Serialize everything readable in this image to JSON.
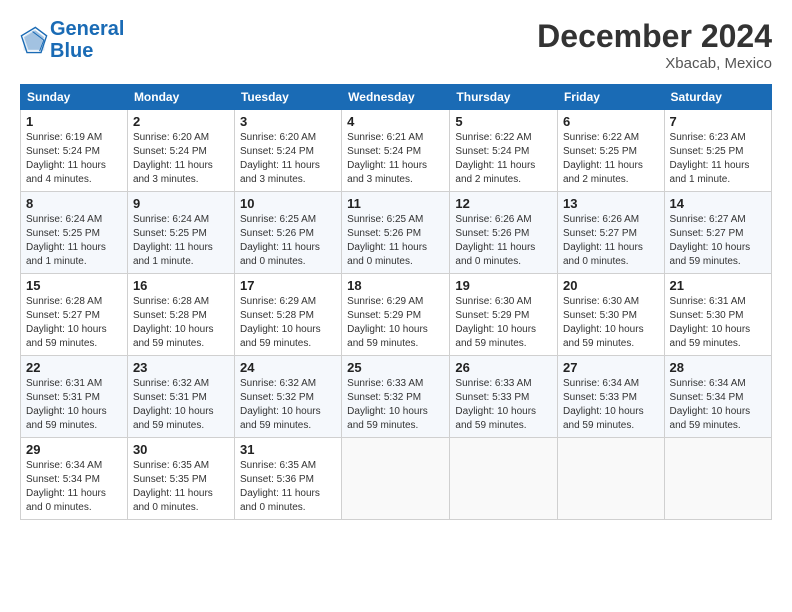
{
  "header": {
    "logo_line1": "General",
    "logo_line2": "Blue",
    "month_title": "December 2024",
    "location": "Xbacab, Mexico"
  },
  "weekdays": [
    "Sunday",
    "Monday",
    "Tuesday",
    "Wednesday",
    "Thursday",
    "Friday",
    "Saturday"
  ],
  "weeks": [
    [
      {
        "day": "1",
        "sunrise": "6:19 AM",
        "sunset": "5:24 PM",
        "daylight": "11 hours and 4 minutes."
      },
      {
        "day": "2",
        "sunrise": "6:20 AM",
        "sunset": "5:24 PM",
        "daylight": "11 hours and 3 minutes."
      },
      {
        "day": "3",
        "sunrise": "6:20 AM",
        "sunset": "5:24 PM",
        "daylight": "11 hours and 3 minutes."
      },
      {
        "day": "4",
        "sunrise": "6:21 AM",
        "sunset": "5:24 PM",
        "daylight": "11 hours and 3 minutes."
      },
      {
        "day": "5",
        "sunrise": "6:22 AM",
        "sunset": "5:24 PM",
        "daylight": "11 hours and 2 minutes."
      },
      {
        "day": "6",
        "sunrise": "6:22 AM",
        "sunset": "5:25 PM",
        "daylight": "11 hours and 2 minutes."
      },
      {
        "day": "7",
        "sunrise": "6:23 AM",
        "sunset": "5:25 PM",
        "daylight": "11 hours and 1 minute."
      }
    ],
    [
      {
        "day": "8",
        "sunrise": "6:24 AM",
        "sunset": "5:25 PM",
        "daylight": "11 hours and 1 minute."
      },
      {
        "day": "9",
        "sunrise": "6:24 AM",
        "sunset": "5:25 PM",
        "daylight": "11 hours and 1 minute."
      },
      {
        "day": "10",
        "sunrise": "6:25 AM",
        "sunset": "5:26 PM",
        "daylight": "11 hours and 0 minutes."
      },
      {
        "day": "11",
        "sunrise": "6:25 AM",
        "sunset": "5:26 PM",
        "daylight": "11 hours and 0 minutes."
      },
      {
        "day": "12",
        "sunrise": "6:26 AM",
        "sunset": "5:26 PM",
        "daylight": "11 hours and 0 minutes."
      },
      {
        "day": "13",
        "sunrise": "6:26 AM",
        "sunset": "5:27 PM",
        "daylight": "11 hours and 0 minutes."
      },
      {
        "day": "14",
        "sunrise": "6:27 AM",
        "sunset": "5:27 PM",
        "daylight": "10 hours and 59 minutes."
      }
    ],
    [
      {
        "day": "15",
        "sunrise": "6:28 AM",
        "sunset": "5:27 PM",
        "daylight": "10 hours and 59 minutes."
      },
      {
        "day": "16",
        "sunrise": "6:28 AM",
        "sunset": "5:28 PM",
        "daylight": "10 hours and 59 minutes."
      },
      {
        "day": "17",
        "sunrise": "6:29 AM",
        "sunset": "5:28 PM",
        "daylight": "10 hours and 59 minutes."
      },
      {
        "day": "18",
        "sunrise": "6:29 AM",
        "sunset": "5:29 PM",
        "daylight": "10 hours and 59 minutes."
      },
      {
        "day": "19",
        "sunrise": "6:30 AM",
        "sunset": "5:29 PM",
        "daylight": "10 hours and 59 minutes."
      },
      {
        "day": "20",
        "sunrise": "6:30 AM",
        "sunset": "5:30 PM",
        "daylight": "10 hours and 59 minutes."
      },
      {
        "day": "21",
        "sunrise": "6:31 AM",
        "sunset": "5:30 PM",
        "daylight": "10 hours and 59 minutes."
      }
    ],
    [
      {
        "day": "22",
        "sunrise": "6:31 AM",
        "sunset": "5:31 PM",
        "daylight": "10 hours and 59 minutes."
      },
      {
        "day": "23",
        "sunrise": "6:32 AM",
        "sunset": "5:31 PM",
        "daylight": "10 hours and 59 minutes."
      },
      {
        "day": "24",
        "sunrise": "6:32 AM",
        "sunset": "5:32 PM",
        "daylight": "10 hours and 59 minutes."
      },
      {
        "day": "25",
        "sunrise": "6:33 AM",
        "sunset": "5:32 PM",
        "daylight": "10 hours and 59 minutes."
      },
      {
        "day": "26",
        "sunrise": "6:33 AM",
        "sunset": "5:33 PM",
        "daylight": "10 hours and 59 minutes."
      },
      {
        "day": "27",
        "sunrise": "6:34 AM",
        "sunset": "5:33 PM",
        "daylight": "10 hours and 59 minutes."
      },
      {
        "day": "28",
        "sunrise": "6:34 AM",
        "sunset": "5:34 PM",
        "daylight": "10 hours and 59 minutes."
      }
    ],
    [
      {
        "day": "29",
        "sunrise": "6:34 AM",
        "sunset": "5:34 PM",
        "daylight": "11 hours and 0 minutes."
      },
      {
        "day": "30",
        "sunrise": "6:35 AM",
        "sunset": "5:35 PM",
        "daylight": "11 hours and 0 minutes."
      },
      {
        "day": "31",
        "sunrise": "6:35 AM",
        "sunset": "5:36 PM",
        "daylight": "11 hours and 0 minutes."
      },
      null,
      null,
      null,
      null
    ]
  ]
}
